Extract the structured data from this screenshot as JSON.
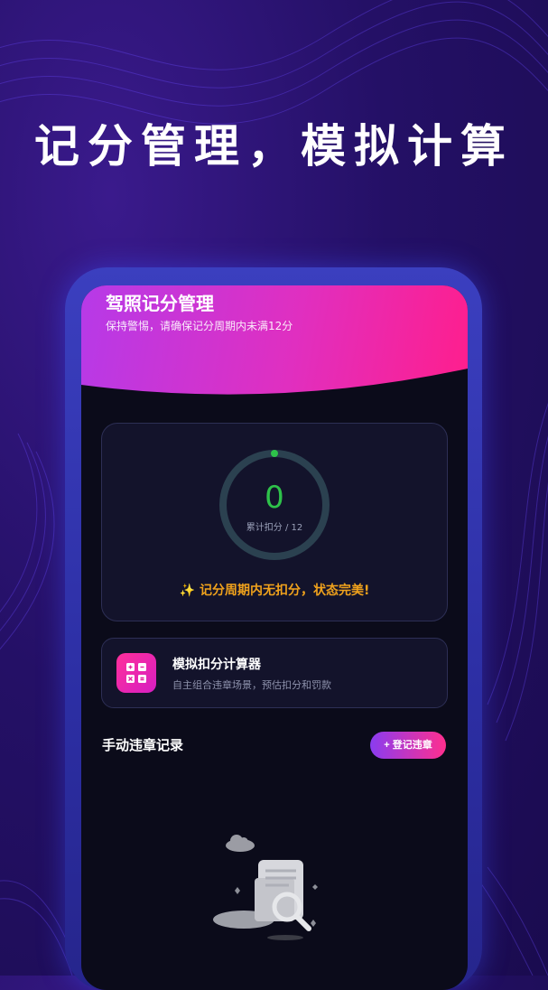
{
  "promo": {
    "headline": "记分管理，模拟计算"
  },
  "app": {
    "title": "驾照记分管理",
    "subtitle": "保持警惕，请确保记分周期内未满12分"
  },
  "score_card": {
    "value": "0",
    "label": "累计扣分 / 12",
    "progress": 0,
    "status": "✨ 记分周期内无扣分，状态完美!"
  },
  "calculator": {
    "title": "模拟扣分计算器",
    "description": "自主组合违章场景，预估扣分和罚款",
    "icon": "calculator-icon"
  },
  "records": {
    "section_title": "手动违章记录",
    "register_button": "+ 登记违章",
    "empty_icon": "empty-document-search-icon"
  },
  "colors": {
    "accent_pink": "#ff1e8c",
    "accent_purple": "#b63ae8",
    "score_green": "#2ec24a",
    "status_orange": "#f0a21c"
  }
}
